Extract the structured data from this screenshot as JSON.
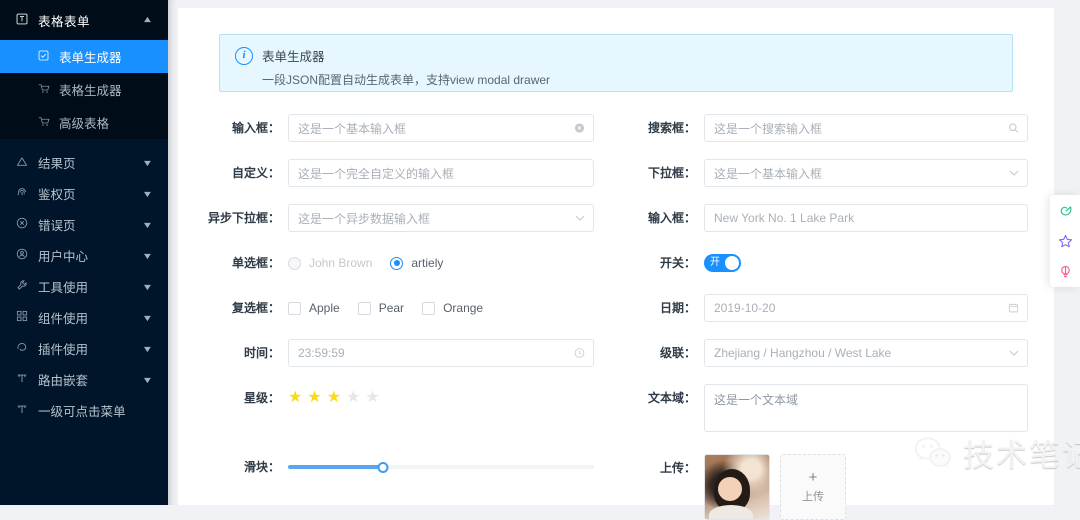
{
  "sidebar": {
    "group": {
      "label": "表格表单",
      "icon": "form-table-icon",
      "expanded_caret": "caret-up-icon"
    },
    "sub_items": [
      {
        "label": "表单生成器",
        "icon": "checkbox-square-icon",
        "active": true
      },
      {
        "label": "表格生成器",
        "icon": "cart-icon",
        "active": false
      },
      {
        "label": "高级表格",
        "icon": "cart-icon",
        "active": false
      }
    ],
    "items": [
      {
        "label": "结果页",
        "icon": "triangle-icon",
        "caret": "caret-down-icon"
      },
      {
        "label": "鉴权页",
        "icon": "fingerprint-icon",
        "caret": "caret-down-icon"
      },
      {
        "label": "错误页",
        "icon": "close-circle-icon",
        "caret": "caret-down-icon"
      },
      {
        "label": "用户中心",
        "icon": "user-circle-icon",
        "caret": "caret-down-icon"
      },
      {
        "label": "工具使用",
        "icon": "tool-icon",
        "caret": "caret-down-icon"
      },
      {
        "label": "组件使用",
        "icon": "components-icon",
        "caret": "caret-down-icon"
      },
      {
        "label": "插件使用",
        "icon": "plugin-icon",
        "caret": "caret-down-icon"
      },
      {
        "label": "路由嵌套",
        "icon": "branch-icon",
        "caret": "caret-down-icon"
      },
      {
        "label": "一级可点击菜单",
        "icon": "branch-icon",
        "caret": ""
      }
    ]
  },
  "alert": {
    "icon": "info-circle-icon",
    "title": "表单生成器",
    "description": "一段JSON配置自动生成表单，支持view modal drawer"
  },
  "form": {
    "left": {
      "input_box": {
        "label": "输入框：",
        "value": "这是一个基本输入框",
        "suffix_icon": "clear-circle-icon"
      },
      "custom": {
        "label": "自定义：",
        "value": "这是一个完全自定义的输入框",
        "suffix_icon": ""
      },
      "async_select": {
        "label": "异步下拉框：",
        "value": "这是一个异步数据输入框",
        "suffix_icon": "chevron-down-icon"
      },
      "radio": {
        "label": "单选框：",
        "options": [
          {
            "text": "John Brown",
            "selected": false,
            "disabled": true
          },
          {
            "text": "artiely",
            "selected": true,
            "disabled": false
          }
        ]
      },
      "checkbox": {
        "label": "复选框：",
        "options": [
          {
            "text": "Apple",
            "checked": false
          },
          {
            "text": "Pear",
            "checked": false
          },
          {
            "text": "Orange",
            "checked": false
          }
        ]
      },
      "time": {
        "label": "时间：",
        "value": "23:59:59",
        "suffix_icon": "clock-icon"
      },
      "rate": {
        "label": "星级：",
        "value": 3,
        "max": 5,
        "star_color": "#fadb14"
      },
      "slider": {
        "label": "滑块：",
        "value": 31,
        "min": 0,
        "max": 100,
        "fill_color": "#5aa7f0"
      }
    },
    "right": {
      "search_box": {
        "label": "搜索框：",
        "value": "这是一个搜索输入框",
        "suffix_icon": "search-icon"
      },
      "select": {
        "label": "下拉框：",
        "value": "这是一个基本输入框",
        "suffix_icon": "chevron-down-icon"
      },
      "input_box": {
        "label": "输入框：",
        "value": "New York No. 1 Lake Park",
        "suffix_icon": ""
      },
      "switch": {
        "label": "开关：",
        "state_text": "开",
        "on": true,
        "on_color": "#1890ff"
      },
      "date": {
        "label": "日期：",
        "value": "2019-10-20",
        "suffix_icon": "calendar-icon"
      },
      "cascader": {
        "label": "级联：",
        "value": "Zhejiang / Hangzhou / West Lake",
        "suffix_icon": "chevron-down-icon"
      },
      "textarea": {
        "label": "文本域：",
        "value": "这是一个文本域"
      },
      "upload": {
        "label": "上传：",
        "thumbnail_alt": "uploaded-photo",
        "plus": "+",
        "button_text": "上传"
      }
    }
  },
  "floatbar": {
    "buttons": [
      {
        "name": "theme-leaf-icon",
        "color": "#2fc28c"
      },
      {
        "name": "star-icon",
        "color": "#7a6ff0"
      },
      {
        "name": "bulb-icon",
        "color": "#ef5f87"
      }
    ]
  },
  "watermark": {
    "logo": "wechat-icon",
    "text": "技术笔记与开源分享"
  }
}
